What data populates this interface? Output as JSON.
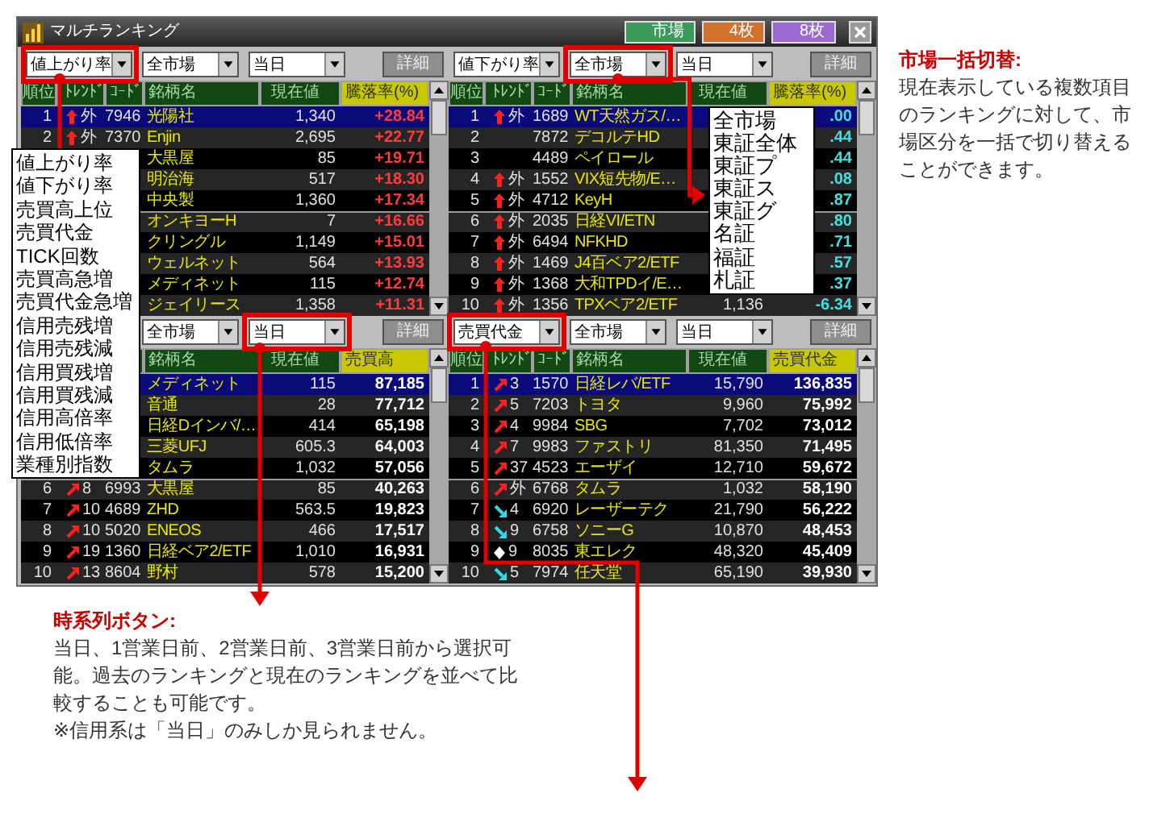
{
  "window": {
    "title": "マルチランキング",
    "buttons": [
      {
        "label": "市場",
        "color": "#3c9a5c"
      },
      {
        "label": "4枚",
        "color": "#d2702c"
      },
      {
        "label": "8枚",
        "color": "#9a6ad0"
      }
    ]
  },
  "panels": [
    {
      "kind": "gainers",
      "selectors": [
        "値上がり率",
        "全市場",
        "当日"
      ],
      "detail_button": "詳細",
      "columns": [
        "順位",
        "ﾄﾚﾝﾄﾞ",
        "ｺｰﾄﾞ",
        "銘柄名",
        "現在値",
        "騰落率(%)"
      ],
      "rows": [
        {
          "rank": "1",
          "trend": {
            "kind": "up",
            "text": "外"
          },
          "code": "7946",
          "name": "光陽社",
          "price": "1,340",
          "value": "+28.84",
          "selected": true
        },
        {
          "rank": "2",
          "trend": {
            "kind": "up",
            "text": "外"
          },
          "code": "7370",
          "name": "Enjin",
          "price": "2,695",
          "value": "+22.77",
          "selected": false
        },
        {
          "name": "大黒屋",
          "price": "85",
          "value": "+19.71",
          "selected": false
        },
        {
          "name": "明治海",
          "price": "517",
          "value": "+18.30",
          "selected": false
        },
        {
          "name": "中央製",
          "price": "1,360",
          "value": "+17.34",
          "selected": false
        },
        {
          "name": "オンキヨーH",
          "price": "7",
          "value": "+16.66",
          "selected": false
        },
        {
          "name": "クリングル",
          "price": "1,149",
          "value": "+15.01",
          "selected": false
        },
        {
          "name": "ウェルネット",
          "price": "564",
          "value": "+13.93",
          "selected": false
        },
        {
          "name": "メディネット",
          "price": "115",
          "value": "+12.74",
          "selected": false
        },
        {
          "name": "ジェイリース",
          "price": "1,358",
          "value": "+11.31",
          "selected": false
        }
      ]
    },
    {
      "kind": "losers",
      "selectors": [
        "値下がり率",
        "全市場",
        "当日"
      ],
      "detail_button": "詳細",
      "columns": [
        "順位",
        "ﾄﾚﾝﾄﾞ",
        "ｺｰﾄﾞ",
        "銘柄名",
        "現在値",
        "騰落率(%)"
      ],
      "rows": [
        {
          "rank": "1",
          "trend": {
            "kind": "up",
            "text": "外"
          },
          "code": "1689",
          "name": "WT天然ガス/…",
          "value": ".00",
          "selected": true
        },
        {
          "rank": "2",
          "code": "7872",
          "name": "デコルテHD",
          "value": ".44",
          "selected": false
        },
        {
          "rank": "3",
          "code": "4489",
          "name": "ペイロール",
          "value": ".44",
          "selected": false
        },
        {
          "rank": "4",
          "trend": {
            "kind": "up",
            "text": "外"
          },
          "code": "1552",
          "name": "VIX短先物/E…",
          "value": ".08",
          "selected": false
        },
        {
          "rank": "5",
          "trend": {
            "kind": "up",
            "text": "外"
          },
          "code": "4712",
          "name": "KeyH",
          "value": ".87",
          "selected": false
        },
        {
          "rank": "6",
          "trend": {
            "kind": "up",
            "text": "外"
          },
          "code": "2035",
          "name": "日経VI/ETN",
          "value": ".80",
          "selected": false
        },
        {
          "rank": "7",
          "trend": {
            "kind": "up",
            "text": "外"
          },
          "code": "6494",
          "name": "NFKHD",
          "value": ".71",
          "selected": false
        },
        {
          "rank": "8",
          "trend": {
            "kind": "up",
            "text": "外"
          },
          "code": "1469",
          "name": "J4百ベア2/ETF",
          "value": ".57",
          "selected": false
        },
        {
          "rank": "9",
          "trend": {
            "kind": "up",
            "text": "外"
          },
          "code": "1368",
          "name": "大和TPDイ/E…",
          "value": ".37",
          "selected": false
        },
        {
          "rank": "10",
          "trend": {
            "kind": "up",
            "text": "外"
          },
          "code": "1356",
          "name": "TPXベア2/ETF",
          "price": "1,136",
          "value": "-6.34",
          "selected": false
        }
      ]
    },
    {
      "kind": "volume",
      "selectors": [
        "全市場",
        "当日"
      ],
      "detail_button": "詳細",
      "columns": [
        "銘柄名",
        "現在値",
        "売買高"
      ],
      "rows": [
        {
          "name": "メディネット",
          "price": "115",
          "value": "87,185",
          "selected": true
        },
        {
          "name": "音通",
          "price": "28",
          "value": "77,712",
          "selected": false
        },
        {
          "name": "日経Dインバ/…",
          "price": "414",
          "value": "65,198",
          "selected": false
        },
        {
          "name": "三菱UFJ",
          "price": "605.3",
          "value": "64,003",
          "selected": false
        },
        {
          "name": "タムラ",
          "price": "1,032",
          "value": "57,056",
          "selected": false
        },
        {
          "rank": "6",
          "trend": {
            "kind": "up-right",
            "text": "8"
          },
          "code": "6993",
          "name": "大黒屋",
          "price": "85",
          "value": "40,263",
          "selected": false
        },
        {
          "rank": "7",
          "trend": {
            "kind": "up-right",
            "text": "10"
          },
          "code": "4689",
          "name": "ZHD",
          "price": "563.5",
          "value": "19,823",
          "selected": false
        },
        {
          "rank": "8",
          "trend": {
            "kind": "up-right",
            "text": "10"
          },
          "code": "5020",
          "name": "ENEOS",
          "price": "466",
          "value": "17,517",
          "selected": false
        },
        {
          "rank": "9",
          "trend": {
            "kind": "up-right",
            "text": "19"
          },
          "code": "1360",
          "name": "日経ベア2/ETF",
          "price": "1,010",
          "value": "16,931",
          "selected": false
        },
        {
          "rank": "10",
          "trend": {
            "kind": "up-right",
            "text": "13"
          },
          "code": "8604",
          "name": "野村",
          "price": "578",
          "value": "15,200",
          "selected": false
        }
      ]
    },
    {
      "kind": "turnover",
      "selectors": [
        "売買代金",
        "全市場",
        "当日"
      ],
      "detail_button": "詳細",
      "columns": [
        "順位",
        "ﾄﾚﾝﾄﾞ",
        "ｺｰﾄﾞ",
        "銘柄名",
        "現在値",
        "売買代金"
      ],
      "rows": [
        {
          "rank": "1",
          "trend": {
            "kind": "up-right",
            "text": "3"
          },
          "code": "1570",
          "name": "日経レバ/ETF",
          "price": "15,790",
          "value": "136,835",
          "selected": true
        },
        {
          "rank": "2",
          "trend": {
            "kind": "up-right",
            "text": "5"
          },
          "code": "7203",
          "name": "トヨタ",
          "price": "9,960",
          "value": "75,992",
          "selected": false
        },
        {
          "rank": "3",
          "trend": {
            "kind": "up-right",
            "text": "4"
          },
          "code": "9984",
          "name": "SBG",
          "price": "7,702",
          "value": "73,012",
          "selected": false
        },
        {
          "rank": "4",
          "trend": {
            "kind": "up-right",
            "text": "7"
          },
          "code": "9983",
          "name": "ファストリ",
          "price": "81,350",
          "value": "71,495",
          "selected": false
        },
        {
          "rank": "5",
          "trend": {
            "kind": "up-right",
            "text": "37"
          },
          "code": "4523",
          "name": "エーザイ",
          "price": "12,710",
          "value": "59,672",
          "selected": false
        },
        {
          "rank": "6",
          "trend": {
            "kind": "up-right",
            "text": "外"
          },
          "code": "6768",
          "name": "タムラ",
          "price": "1,032",
          "value": "58,190",
          "selected": false
        },
        {
          "rank": "7",
          "trend": {
            "kind": "down-right",
            "text": "4"
          },
          "code": "6920",
          "name": "レーザーテク",
          "price": "21,790",
          "value": "56,222",
          "selected": false
        },
        {
          "rank": "8",
          "trend": {
            "kind": "down-right",
            "text": "9"
          },
          "code": "6758",
          "name": "ソニーG",
          "price": "10,870",
          "value": "48,453",
          "selected": false
        },
        {
          "rank": "9",
          "trend": {
            "kind": "flat",
            "text": "9"
          },
          "code": "8035",
          "name": "東エレク",
          "price": "48,320",
          "value": "45,409",
          "selected": false
        },
        {
          "rank": "10",
          "trend": {
            "kind": "down-right",
            "text": "5"
          },
          "code": "7974",
          "name": "任天堂",
          "price": "65,190",
          "value": "39,930",
          "selected": false
        }
      ]
    }
  ],
  "ranking_menu": {
    "items": [
      "値上がり率",
      "値下がり率",
      "売買高上位",
      "売買代金",
      "TICK回数",
      "売買高急増",
      "売買代金急増",
      "信用売残増",
      "信用売残減",
      "信用買残増",
      "信用買残減",
      "信用高倍率",
      "信用低倍率",
      "業種別指数"
    ]
  },
  "market_menu": {
    "items": [
      "全市場",
      "東証全体",
      "東証プ",
      "東証ス",
      "東証グ",
      "名証",
      "福証",
      "札証"
    ]
  },
  "notes": [
    {
      "title": "市場一括切替:",
      "paragraphs": [
        "現在表示している複数項目のランキングに対して、市場区分を一括で切り替えることができます。"
      ]
    },
    {
      "title": "時系列ボタン:",
      "paragraphs": [
        "当日、1営業日前、2営業日前、3営業日前から選択可能。過去のランキングと現在のランキングを並べて比較することも可能です。",
        "※信用系は「当日」のみしか見られません。"
      ]
    }
  ]
}
